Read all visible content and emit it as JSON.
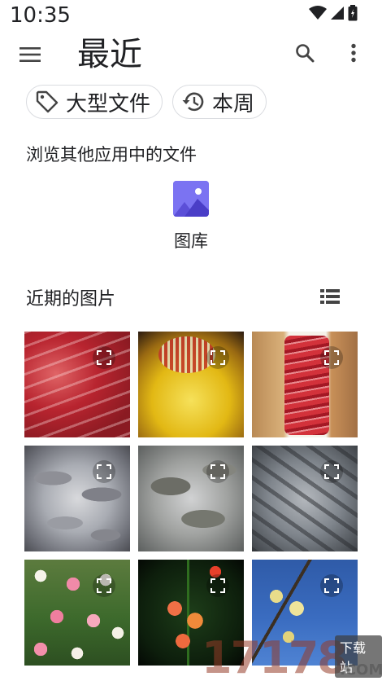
{
  "status_bar": {
    "time": "10:35"
  },
  "app_bar": {
    "title": "最近"
  },
  "filter_chips": [
    {
      "label": "大型文件",
      "icon": "label-tag-icon"
    },
    {
      "label": "本周",
      "icon": "history-clock-icon"
    }
  ],
  "browse_section": {
    "heading": "浏览其他应用中的文件",
    "apps": [
      {
        "label": "图库",
        "icon": "gallery-icon",
        "icon_color": "#7b73f2"
      }
    ]
  },
  "recent_section": {
    "heading": "近期的图片",
    "view_toggle_icon": "list-view-icon"
  },
  "images": [
    {
      "subject": "beef-slices"
    },
    {
      "subject": "hotpot"
    },
    {
      "subject": "beef-platter"
    },
    {
      "subject": "fish-1"
    },
    {
      "subject": "fish-2"
    },
    {
      "subject": "fish-3"
    },
    {
      "subject": "tulips"
    },
    {
      "subject": "orange-flowers"
    },
    {
      "subject": "plum-blossom"
    }
  ],
  "watermark": {
    "number": "17178",
    "badge": "下载站",
    "suffix": ".COM"
  }
}
